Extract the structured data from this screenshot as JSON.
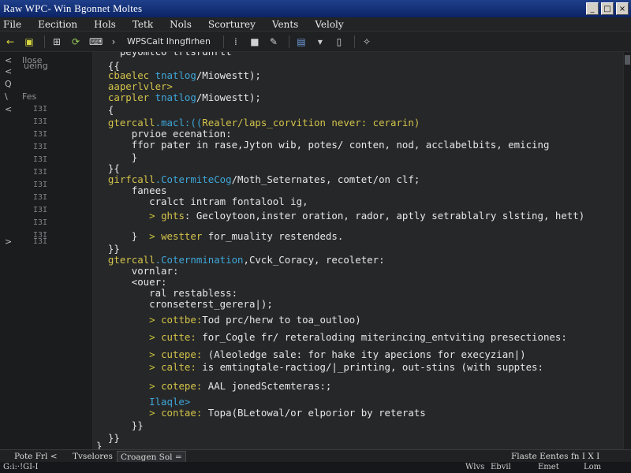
{
  "window": {
    "title": "Raw WPC- Win Bgonnet Moltes",
    "minimize_glyph": "_",
    "maximize_glyph": "□",
    "close_glyph": "×"
  },
  "menu": [
    "File",
    "Eecition",
    "Hols",
    "Tetk",
    "Nols",
    "Scorturey",
    "Vents",
    "Veloly"
  ],
  "toolbar": {
    "file_label": "WPSCalt Ihngfirhen",
    "icons": [
      "back-arrow-icon",
      "folder-icon",
      "save-icon",
      "refresh-icon",
      "code-icon",
      "chevron-right-icon",
      "grid-icon",
      "bookmark-icon",
      "edit-icon",
      "image-icon",
      "dropdown-icon",
      "device-icon",
      "tools-icon"
    ]
  },
  "sidebar": {
    "rows": [
      {
        "icon": "<",
        "text": "Ilose",
        "num": ""
      },
      {
        "icon": "<",
        "text": "ueing",
        "num": ""
      },
      {
        "icon": "Q",
        "text": "",
        "num": ""
      },
      {
        "icon": "\\",
        "text": "Fes",
        "num": ""
      },
      {
        "icon": "<",
        "text": "",
        "num": "I3I"
      },
      {
        "icon": "",
        "text": "",
        "num": "I3I"
      },
      {
        "icon": "",
        "text": "",
        "num": "I3I"
      },
      {
        "icon": "",
        "text": "",
        "num": "I3I"
      },
      {
        "icon": "",
        "text": "",
        "num": "I3I"
      },
      {
        "icon": "",
        "text": "",
        "num": "I3I"
      },
      {
        "icon": "",
        "text": "",
        "num": "I3I"
      },
      {
        "icon": "",
        "text": "",
        "num": "I3I"
      },
      {
        "icon": "",
        "text": "",
        "num": "I3I"
      },
      {
        "icon": "",
        "text": "",
        "num": "I3I"
      },
      {
        "icon": "",
        "text": "",
        "num": "I3I"
      },
      {
        "icon": ">",
        "text": "",
        "num": "I3I"
      }
    ],
    "row_tops": [
      "Ilose",
      "ueing",
      "Q",
      "Fes",
      "I3I-1",
      "I3I-2",
      "I3I-3",
      "I3I-4",
      "I3I-5",
      "I3I-6",
      "I3I-7",
      "I3I-8",
      "I3I-9",
      "I3I-10",
      "I3I-11",
      "I3I-12"
    ]
  },
  "editor": {
    "lines": [
      [
        {
          "c": "pl",
          "t": "    peyomtco trtsrdnrtt"
        }
      ],
      [
        {
          "c": "pl",
          "t": "  {{"
        }
      ],
      [
        {
          "c": "kw",
          "t": "  cbaelec "
        },
        {
          "c": "fn",
          "t": "tnatlog"
        },
        {
          "c": "pl",
          "t": "/Miowestt);"
        }
      ],
      [
        {
          "c": "kw",
          "t": "  aaperlvler>"
        }
      ],
      [
        {
          "c": "kw",
          "t": "  carpler "
        },
        {
          "c": "fn",
          "t": "tnatlog"
        },
        {
          "c": "pl",
          "t": "/Miowestt);"
        }
      ],
      [
        {
          "c": "pl",
          "t": "  {"
        }
      ],
      [
        {
          "c": "kw",
          "t": "  gtercall"
        },
        {
          "c": "fn",
          "t": ".macl:(("
        },
        {
          "c": "kw",
          "t": "Realer/laps_corvition never: cerarin)"
        }
      ],
      [
        {
          "c": "pl",
          "t": "      prvioe ecenation:"
        }
      ],
      [
        {
          "c": "pl",
          "t": "      ffor pater in rase,Jyton wib, potes/ conten, nod, acclabelbits, emicing"
        }
      ],
      [
        {
          "c": "pl",
          "t": "      }"
        }
      ],
      [
        {
          "c": "pl",
          "t": "  }{"
        }
      ],
      [
        {
          "c": "kw",
          "t": "  girfcall"
        },
        {
          "c": "fn",
          "t": ".CotermiteCog"
        },
        {
          "c": "pl",
          "t": "/Moth_Seternates, comtet/on clf;"
        }
      ],
      [
        {
          "c": "pl",
          "t": "      fanees"
        }
      ],
      [
        {
          "c": "pl",
          "t": "         cralct intram fontalool ig,"
        }
      ],
      [
        {
          "c": "ar",
          "t": "         > "
        },
        {
          "c": "kw",
          "t": "ghts"
        },
        {
          "c": "pl",
          "t": ": Gecloytoon,inster oration, rador, aptly setrablalry slsting, hett)"
        }
      ],
      [
        {
          "c": "pl",
          "t": "      }  "
        },
        {
          "c": "ar",
          "t": "> "
        },
        {
          "c": "kw",
          "t": "westter"
        },
        {
          "c": "pl",
          "t": " for_muality restendeds."
        }
      ],
      [
        {
          "c": "pl",
          "t": "  }}"
        }
      ],
      [
        {
          "c": "kw",
          "t": "  gtercall"
        },
        {
          "c": "fn",
          "t": ".Coternmination"
        },
        {
          "c": "pl",
          "t": ",Cvck_Coracy, recoleter:"
        }
      ],
      [
        {
          "c": "pl",
          "t": "      vornlar:"
        }
      ],
      [
        {
          "c": "pl",
          "t": "      <ouer:"
        }
      ],
      [
        {
          "c": "pl",
          "t": "         ral restabless:"
        }
      ],
      [
        {
          "c": "pl",
          "t": "         cronseterst_gerera|);"
        }
      ],
      [
        {
          "c": "ar",
          "t": "         > "
        },
        {
          "c": "kw",
          "t": "cottbe:"
        },
        {
          "c": "pl",
          "t": "Tod prc/herw to toa_outloo)"
        }
      ],
      [
        {
          "c": "ar",
          "t": "         > "
        },
        {
          "c": "kw",
          "t": "cutte:"
        },
        {
          "c": "pl",
          "t": " for_Cogle fr/ reteraloding miterincing_entviting presectiones:"
        }
      ],
      [
        {
          "c": "ar",
          "t": "         > "
        },
        {
          "c": "kw",
          "t": "cutepe:"
        },
        {
          "c": "pl",
          "t": " (Aleoledge sale: for hake ity apecions for execyzian|)"
        }
      ],
      [
        {
          "c": "ar",
          "t": "         > "
        },
        {
          "c": "kw",
          "t": "calte:"
        },
        {
          "c": "pl",
          "t": " is emtingtale-ractiog/|_printing, out-stins (with supptes:"
        }
      ],
      [
        {
          "c": "ar",
          "t": "         > "
        },
        {
          "c": "kw",
          "t": "cotepe:"
        },
        {
          "c": "pl",
          "t": " AAL jonedSctemteras:;"
        }
      ],
      [
        {
          "c": "fn",
          "t": "         Ilaqle>"
        }
      ],
      [
        {
          "c": "ar",
          "t": "         > "
        },
        {
          "c": "kw",
          "t": "contae:"
        },
        {
          "c": "pl",
          "t": " Topa(BLetowal/or elporior by reterats"
        }
      ],
      [
        {
          "c": "pl",
          "t": "      }}"
        }
      ],
      [
        {
          "c": "pl",
          "t": "  }}"
        }
      ],
      [
        {
          "c": "pl",
          "t": "}"
        }
      ]
    ]
  },
  "status": {
    "tabs": [
      "Pote Frl <",
      "Tvselores",
      "Croagen Sol ="
    ],
    "right": "Flaste Eentes fn I X I"
  },
  "bottom": {
    "left": "G:i:·!GI-I",
    "items": [
      "Wlvs",
      "Ebvil",
      "Emet",
      "Lom"
    ]
  }
}
